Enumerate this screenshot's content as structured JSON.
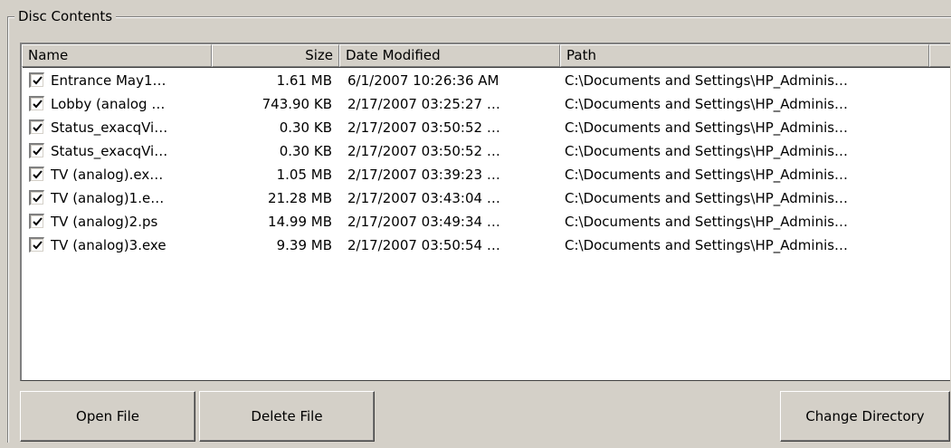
{
  "group": {
    "title": "Disc Contents"
  },
  "list": {
    "columns": [
      {
        "label": "Name"
      },
      {
        "label": "Size"
      },
      {
        "label": "Date Modified"
      },
      {
        "label": "Path"
      }
    ],
    "rows": [
      {
        "checked": true,
        "name": "Entrance May1…",
        "size": "1.61 MB",
        "date": "6/1/2007 10:26:36 AM",
        "path": "C:\\Documents and Settings\\HP_Adminis…"
      },
      {
        "checked": true,
        "name": "Lobby (analog …",
        "size": "743.90 KB",
        "date": "2/17/2007 03:25:27 …",
        "path": "C:\\Documents and Settings\\HP_Adminis…"
      },
      {
        "checked": true,
        "name": "Status_exacqVi…",
        "size": "0.30 KB",
        "date": "2/17/2007 03:50:52 …",
        "path": "C:\\Documents and Settings\\HP_Adminis…"
      },
      {
        "checked": true,
        "name": "Status_exacqVi…",
        "size": "0.30 KB",
        "date": "2/17/2007 03:50:52 …",
        "path": "C:\\Documents and Settings\\HP_Adminis…"
      },
      {
        "checked": true,
        "name": "TV (analog).ex…",
        "size": "1.05 MB",
        "date": "2/17/2007 03:39:23 …",
        "path": "C:\\Documents and Settings\\HP_Adminis…"
      },
      {
        "checked": true,
        "name": "TV (analog)1.e…",
        "size": "21.28 MB",
        "date": "2/17/2007 03:43:04 …",
        "path": "C:\\Documents and Settings\\HP_Adminis…"
      },
      {
        "checked": true,
        "name": "TV (analog)2.ps",
        "size": "14.99 MB",
        "date": "2/17/2007 03:49:34 …",
        "path": "C:\\Documents and Settings\\HP_Adminis…"
      },
      {
        "checked": true,
        "name": "TV (analog)3.exe",
        "size": "9.39 MB",
        "date": "2/17/2007 03:50:54 …",
        "path": "C:\\Documents and Settings\\HP_Adminis…"
      }
    ]
  },
  "buttons": {
    "open": "Open File",
    "delete": "Delete File",
    "change_directory": "Change Directory"
  },
  "icons": {
    "checkbox": "checkmark-icon"
  },
  "colors": {
    "window_bg": "#d4d0c8",
    "list_bg": "#ffffff",
    "text": "#000000"
  }
}
